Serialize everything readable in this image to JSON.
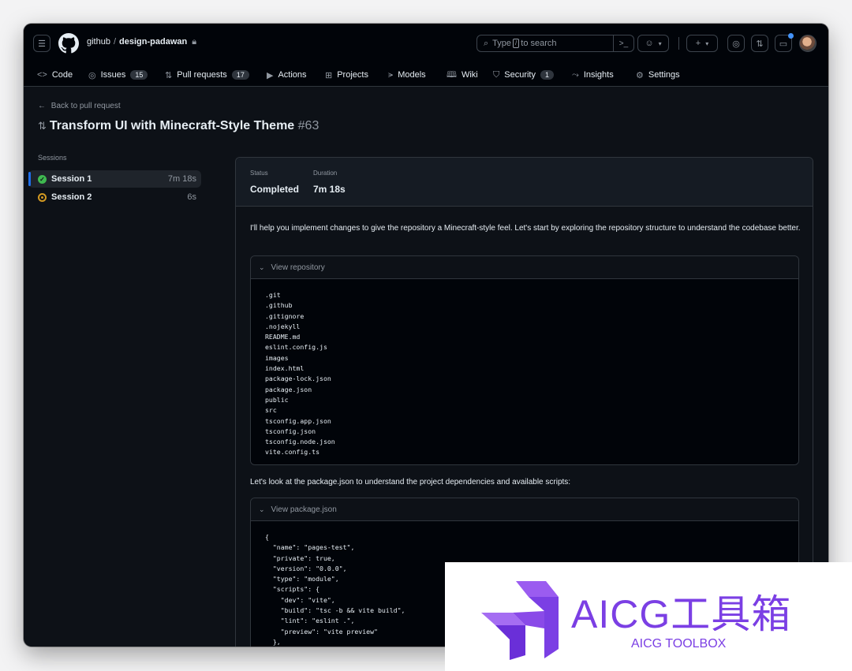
{
  "header": {
    "owner": "github",
    "repo": "design-padawan",
    "search_placeholder_pre": "Type",
    "search_key": "/",
    "search_placeholder_post": "to search"
  },
  "tabs": [
    {
      "label": "Code",
      "icon": "code-icon"
    },
    {
      "label": "Issues",
      "count": "15",
      "icon": "issue-icon"
    },
    {
      "label": "Pull requests",
      "count": "17",
      "icon": "pull-request-icon"
    },
    {
      "label": "Actions",
      "icon": "play-icon"
    },
    {
      "label": "Projects",
      "icon": "table-icon"
    },
    {
      "label": "Models",
      "icon": "models-icon"
    },
    {
      "label": "Wiki",
      "icon": "book-icon"
    },
    {
      "label": "Security",
      "count": "1",
      "icon": "shield-icon"
    },
    {
      "label": "Insights",
      "icon": "graph-icon"
    },
    {
      "label": "Settings",
      "icon": "gear-icon"
    }
  ],
  "back_link": "Back to pull request",
  "title": {
    "text": "Transform UI with Minecraft-Style Theme",
    "number": "#63"
  },
  "sessions": {
    "label": "Sessions",
    "items": [
      {
        "name": "Session 1",
        "duration": "7m 18s",
        "status": "completed"
      },
      {
        "name": "Session 2",
        "duration": "6s",
        "status": "in-progress"
      }
    ]
  },
  "summary": {
    "status_label": "Status",
    "status_value": "Completed",
    "duration_label": "Duration",
    "duration_value": "7m 18s"
  },
  "log": {
    "intro": "I'll help you implement changes to give the repository a Minecraft-style feel. Let's start by exploring the repository structure to understand the codebase better.",
    "box1_title": "View repository",
    "box1_lines": ".git\n.github\n.gitignore\n.nojekyll\nREADME.md\neslint.config.js\nimages\nindex.html\npackage-lock.json\npackage.json\npublic\nsrc\ntsconfig.app.json\ntsconfig.json\ntsconfig.node.json\nvite.config.ts",
    "next": "Let's look at the package.json to understand the project dependencies and available scripts:",
    "box2_title": "View package.json",
    "box2_lines": "{\n  \"name\": \"pages-test\",\n  \"private\": true,\n  \"version\": \"0.0.0\",\n  \"type\": \"module\",\n  \"scripts\": {\n    \"dev\": \"vite\",\n    \"build\": \"tsc -b && vite build\",\n    \"lint\": \"eslint .\",\n    \"preview\": \"vite preview\"\n  },"
  },
  "watermark": {
    "title": "AICG工具箱",
    "subtitle": "AICG TOOLBOX",
    "color": "#7b3fe4"
  },
  "colors": {
    "bg": "#0d1117",
    "accent": "#1f6feb",
    "success": "#3fb950",
    "warning": "#d29922"
  }
}
